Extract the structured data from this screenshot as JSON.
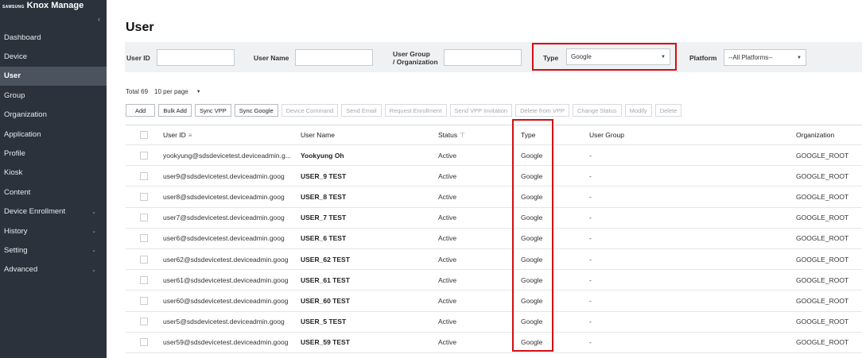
{
  "brand": {
    "small": "SAMSUNG",
    "main": "Knox Manage"
  },
  "sidebar": {
    "collapse_icon": "chevron-left-icon",
    "items": [
      {
        "label": "Dashboard",
        "has_children": false,
        "active": false
      },
      {
        "label": "Device",
        "has_children": false,
        "active": false
      },
      {
        "label": "User",
        "has_children": false,
        "active": true
      },
      {
        "label": "Group",
        "has_children": false,
        "active": false
      },
      {
        "label": "Organization",
        "has_children": false,
        "active": false
      },
      {
        "label": "Application",
        "has_children": false,
        "active": false
      },
      {
        "label": "Profile",
        "has_children": false,
        "active": false
      },
      {
        "label": "Kiosk",
        "has_children": false,
        "active": false
      },
      {
        "label": "Content",
        "has_children": false,
        "active": false
      },
      {
        "label": "Device Enrollment",
        "has_children": true,
        "active": false
      },
      {
        "label": "History",
        "has_children": true,
        "active": false
      },
      {
        "label": "Setting",
        "has_children": true,
        "active": false
      },
      {
        "label": "Advanced",
        "has_children": true,
        "active": false
      }
    ]
  },
  "page": {
    "title": "User"
  },
  "filters": {
    "user_id": {
      "label": "User ID",
      "value": ""
    },
    "user_name": {
      "label": "User Name",
      "value": ""
    },
    "user_group": {
      "label_line1": "User Group",
      "label_line2": "/ Organization",
      "value": ""
    },
    "type": {
      "label": "Type",
      "value": "Google"
    },
    "platform": {
      "label": "Platform",
      "value": "--All Platforms--"
    }
  },
  "summary": {
    "total_label": "Total",
    "total_value": "69",
    "per_page": "10 per page"
  },
  "toolbar": [
    {
      "label": "Add",
      "enabled": true
    },
    {
      "label": "Bulk Add",
      "enabled": true
    },
    {
      "label": "Sync VPP",
      "enabled": true
    },
    {
      "label": "Sync Google",
      "enabled": true
    },
    {
      "label": "Device Command",
      "enabled": false
    },
    {
      "label": "Send Email",
      "enabled": false
    },
    {
      "label": "Request Enrollment",
      "enabled": false
    },
    {
      "label": "Send VPP Invitation",
      "enabled": false
    },
    {
      "label": "Delete from VPP",
      "enabled": false
    },
    {
      "label": "Change Status",
      "enabled": false
    },
    {
      "label": "Modify",
      "enabled": false
    },
    {
      "label": "Delete",
      "enabled": false
    }
  ],
  "table": {
    "columns": {
      "user_id": "User ID",
      "user_name": "User Name",
      "status": "Status",
      "type": "Type",
      "user_group": "User Group",
      "organization": "Organization"
    },
    "rows": [
      {
        "user_id": "yookyung@sdsdevicetest.deviceadmin.g...",
        "user_name": "Yookyung Oh",
        "status": "Active",
        "type": "Google",
        "user_group": "-",
        "organization": "GOOGLE_ROOT"
      },
      {
        "user_id": "user9@sdsdevicetest.deviceadmin.goog",
        "user_name": "USER_9 TEST",
        "status": "Active",
        "type": "Google",
        "user_group": "-",
        "organization": "GOOGLE_ROOT"
      },
      {
        "user_id": "user8@sdsdevicetest.deviceadmin.goog",
        "user_name": "USER_8 TEST",
        "status": "Active",
        "type": "Google",
        "user_group": "-",
        "organization": "GOOGLE_ROOT"
      },
      {
        "user_id": "user7@sdsdevicetest.deviceadmin.goog",
        "user_name": "USER_7 TEST",
        "status": "Active",
        "type": "Google",
        "user_group": "-",
        "organization": "GOOGLE_ROOT"
      },
      {
        "user_id": "user6@sdsdevicetest.deviceadmin.goog",
        "user_name": "USER_6 TEST",
        "status": "Active",
        "type": "Google",
        "user_group": "-",
        "organization": "GOOGLE_ROOT"
      },
      {
        "user_id": "user62@sdsdevicetest.deviceadmin.goog",
        "user_name": "USER_62 TEST",
        "status": "Active",
        "type": "Google",
        "user_group": "-",
        "organization": "GOOGLE_ROOT"
      },
      {
        "user_id": "user61@sdsdevicetest.deviceadmin.goog",
        "user_name": "USER_61 TEST",
        "status": "Active",
        "type": "Google",
        "user_group": "-",
        "organization": "GOOGLE_ROOT"
      },
      {
        "user_id": "user60@sdsdevicetest.deviceadmin.goog",
        "user_name": "USER_60 TEST",
        "status": "Active",
        "type": "Google",
        "user_group": "-",
        "organization": "GOOGLE_ROOT"
      },
      {
        "user_id": "user5@sdsdevicetest.deviceadmin.goog",
        "user_name": "USER_5 TEST",
        "status": "Active",
        "type": "Google",
        "user_group": "-",
        "organization": "GOOGLE_ROOT"
      },
      {
        "user_id": "user59@sdsdevicetest.deviceadmin.goog",
        "user_name": "USER_59 TEST",
        "status": "Active",
        "type": "Google",
        "user_group": "-",
        "organization": "GOOGLE_ROOT"
      }
    ]
  },
  "icons": {
    "user_id_header": "sort-lines-icon",
    "status_header": "filter-funnel-icon",
    "dropdown": "caret-down-icon",
    "nav_expand": "chevron-down-icon"
  },
  "colors": {
    "sidebar_bg": "#2b323c",
    "sidebar_active": "#4a535e",
    "highlight_red": "#d40d12",
    "filter_bar_bg": "#eff1f3"
  }
}
